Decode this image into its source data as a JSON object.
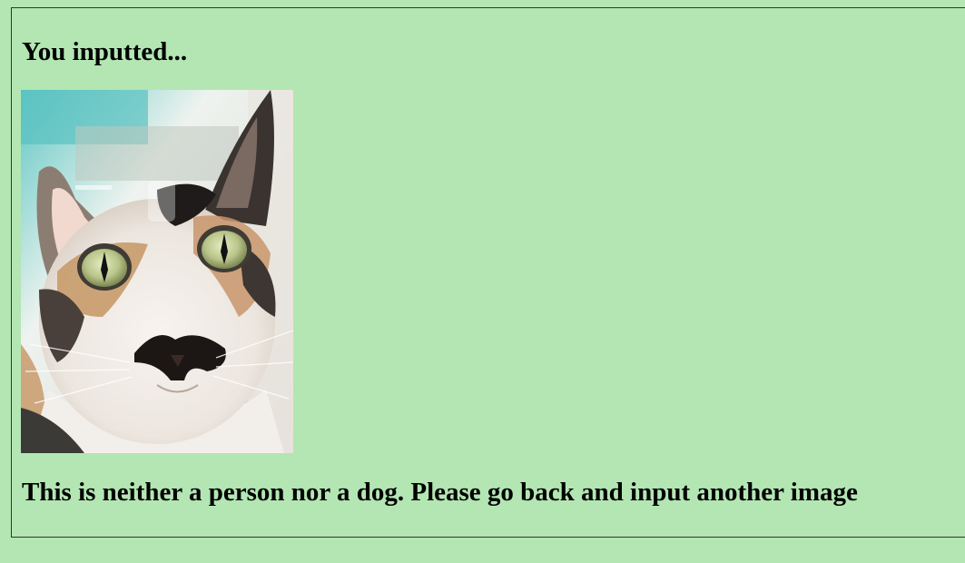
{
  "result_page": {
    "heading": "You inputted...",
    "uploaded_image": {
      "subject": "calico cat face close-up"
    },
    "message": "This is neither a person nor a dog. Please go back and input another image"
  },
  "colors": {
    "page_background": "#b3e6b3",
    "panel_border": "#333333",
    "text": "#000000"
  }
}
